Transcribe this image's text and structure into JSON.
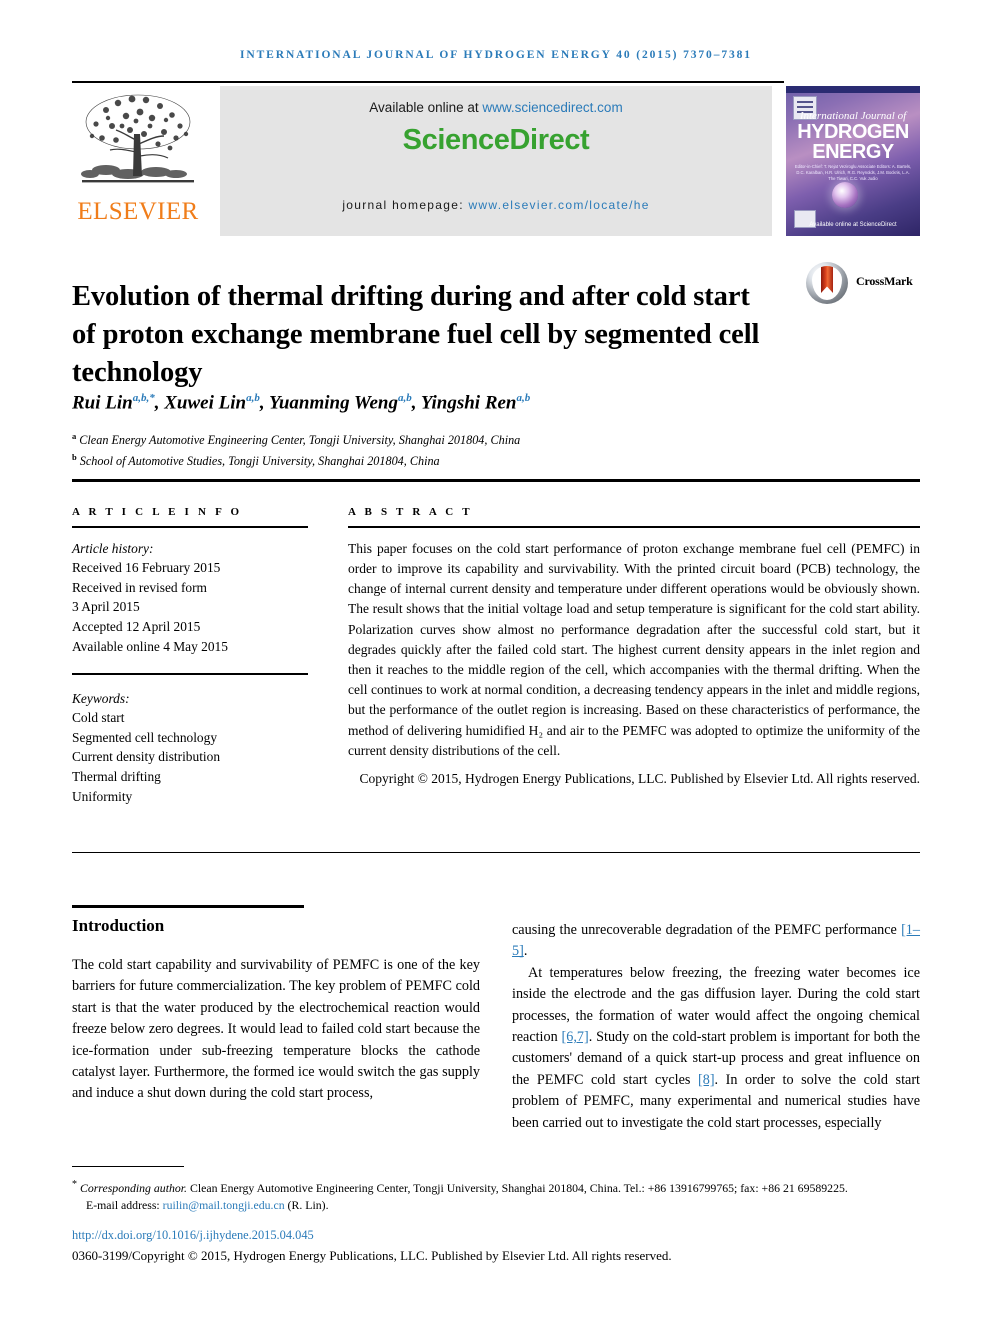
{
  "running_head": "International Journal of Hydrogen Energy 40 (2015) 7370–7381",
  "masthead": {
    "publisher_name": "ELSEVIER",
    "tree_icon": "elsevier-tree-logo",
    "available_prefix": "Available online at ",
    "available_url": "www.sciencedirect.com",
    "sciencedirect_logo": "ScienceDirect",
    "homepage_prefix": "journal homepage: ",
    "homepage_url": "www.elsevier.com/locate/he",
    "cover": {
      "kicker": "International Journal of",
      "line1": "HYDROGEN",
      "line2": "ENERGY",
      "editors": "Editor-in-Chief: T. Nejat Veziroglu   Associate Editors: A. Bartels, D.C. Karalban, H.R. Ulrich, R.G. Reynolds, J.M. Bockris, L.A. The Tiwari, C.C. Vuk Judio",
      "sciencedirect_mark": "Available online at ScienceDirect"
    }
  },
  "article": {
    "title": "Evolution of thermal drifting during and after cold start of proton exchange membrane fuel cell by segmented cell technology",
    "crossmark_label": "CrossMark",
    "authors": [
      {
        "name": "Rui Lin",
        "sup": "a,b,*"
      },
      {
        "name": "Xuwei Lin",
        "sup": "a,b"
      },
      {
        "name": "Yuanming Weng",
        "sup": "a,b"
      },
      {
        "name": "Yingshi Ren",
        "sup": "a,b"
      }
    ],
    "affiliations": [
      {
        "marker": "a",
        "text": "Clean Energy Automotive Engineering Center, Tongji University, Shanghai 201804, China"
      },
      {
        "marker": "b",
        "text": "School of Automotive Studies, Tongji University, Shanghai 201804, China"
      }
    ]
  },
  "article_info": {
    "heading": "A R T I C L E   I N F O",
    "history_label": "Article history:",
    "history": [
      "Received 16 February 2015",
      "Received in revised form",
      "3 April 2015",
      "Accepted 12 April 2015",
      "Available online 4 May 2015"
    ],
    "keywords_label": "Keywords:",
    "keywords": [
      "Cold start",
      "Segmented cell technology",
      "Current density distribution",
      "Thermal drifting",
      "Uniformity"
    ]
  },
  "abstract": {
    "heading": "A B S T R A C T",
    "body": "This paper focuses on the cold start performance of proton exchange membrane fuel cell (PEMFC) in order to improve its capability and survivability. With the printed circuit board (PCB) technology, the change of internal current density and temperature under different operations would be obviously shown. The result shows that the initial voltage load and setup temperature is significant for the cold start ability. Polarization curves show almost no performance degradation after the successful cold start, but it degrades quickly after the failed cold start. The highest current density appears in the inlet region and then it reaches to the middle region of the cell, which accompanies with the thermal drifting. When the cell continues to work at normal condition, a decreasing tendency appears in the inlet and middle regions, but the performance of the outlet region is increasing. Based on these characteristics of performance, the method of delivering humidified H₂ and air to the PEMFC was adopted to optimize the uniformity of the current density distributions of the cell.",
    "copyright": "Copyright © 2015, Hydrogen Energy Publications, LLC. Published by Elsevier Ltd. All rights reserved."
  },
  "body": {
    "section_heading": "Introduction",
    "left_paragraph": "The cold start capability and survivability of PEMFC is one of the key barriers for future commercialization. The key problem of PEMFC cold start is that the water produced by the electrochemical reaction would freeze below zero degrees. It would lead to failed cold start because the ice-formation under sub-freezing temperature blocks the cathode catalyst layer. Furthermore, the formed ice would switch the gas supply and induce a shut down during the cold start process,",
    "right_paragraph_1_pre": "causing the unrecoverable degradation of the PEMFC performance ",
    "right_paragraph_1_ref": "[1–5]",
    "right_paragraph_1_post": ".",
    "right_paragraph_2_a": "At temperatures below freezing, the freezing water becomes ice inside the electrode and the gas diffusion layer. During the cold start processes, the formation of water would affect the ongoing chemical reaction ",
    "right_paragraph_2_ref1": "[6,7]",
    "right_paragraph_2_b": ". Study on the cold-start problem is important for both the customers' demand of a quick start-up process and great influence on the PEMFC cold start cycles ",
    "right_paragraph_2_ref2": "[8]",
    "right_paragraph_2_c": ". In order to solve the cold start problem of PEMFC, many experimental and numerical studies have been carried out to investigate the cold start processes, especially"
  },
  "footer": {
    "corresponding_label": "Corresponding author.",
    "corresponding_text": " Clean Energy Automotive Engineering Center, Tongji University, Shanghai 201804, China. Tel.: +86 13916799765; fax: +86 21 69589225.",
    "email_label": "E-mail address: ",
    "email": "ruilin@mail.tongji.edu.cn",
    "email_suffix": " (R. Lin).",
    "doi": "http://dx.doi.org/10.1016/j.ijhydene.2015.04.045",
    "issn_copyright": "0360-3199/Copyright © 2015, Hydrogen Energy Publications, LLC. Published by Elsevier Ltd. All rights reserved."
  },
  "colors": {
    "link_blue": "#2b7bb9",
    "elsevier_orange": "#f07d1a",
    "sciencedirect_green": "#37a230",
    "band_gray": "#e4e4e4"
  }
}
